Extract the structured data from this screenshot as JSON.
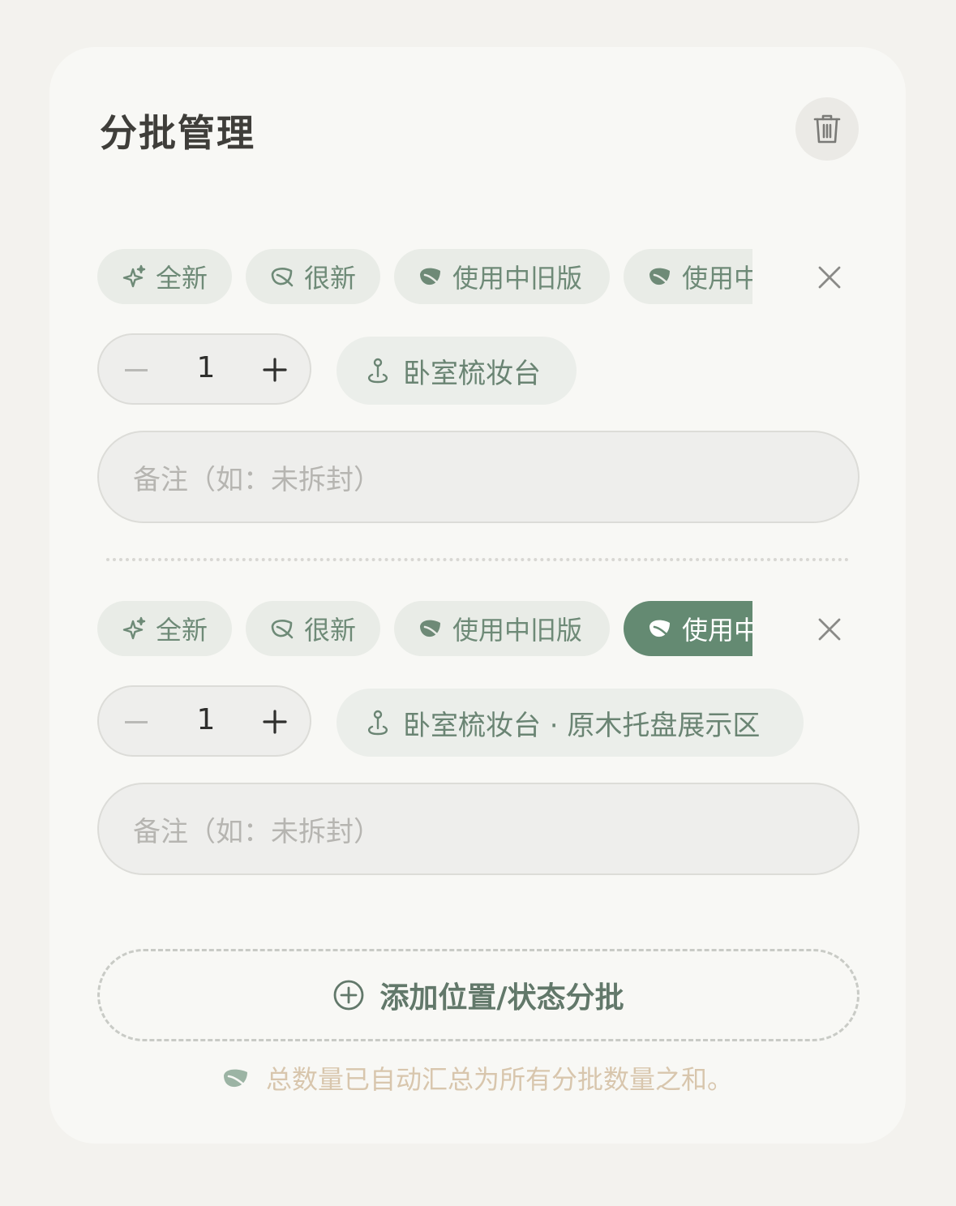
{
  "panel": {
    "title": "分批管理"
  },
  "status_options": [
    "全新",
    "很新",
    "使用中旧版",
    "使用中"
  ],
  "batches": [
    {
      "selected_status": "",
      "quantity": "1",
      "location": "卧室梳妆台",
      "note_placeholder": "备注（如：未拆封）"
    },
    {
      "selected_status": "使用中",
      "quantity": "1",
      "location": "卧室梳妆台 · 原木托盘展示区",
      "note_placeholder": "备注（如：未拆封）"
    }
  ],
  "add_button_label": "添加位置/状态分批",
  "hint_text": "总数量已自动汇总为所有分批数量之和。",
  "colors": {
    "accent": "#648a72",
    "chip_bg": "#e9ece7",
    "hint": "#d8c6ad",
    "background": "#f3f2ee"
  },
  "icons": {
    "delete": "trash-icon",
    "status_new": "sparkle-icon",
    "status_like_new": "leaf-outline-icon",
    "status_used": "leaf-icon",
    "remove_batch": "close-icon",
    "location": "pin-icon",
    "add": "plus-circle-icon"
  }
}
